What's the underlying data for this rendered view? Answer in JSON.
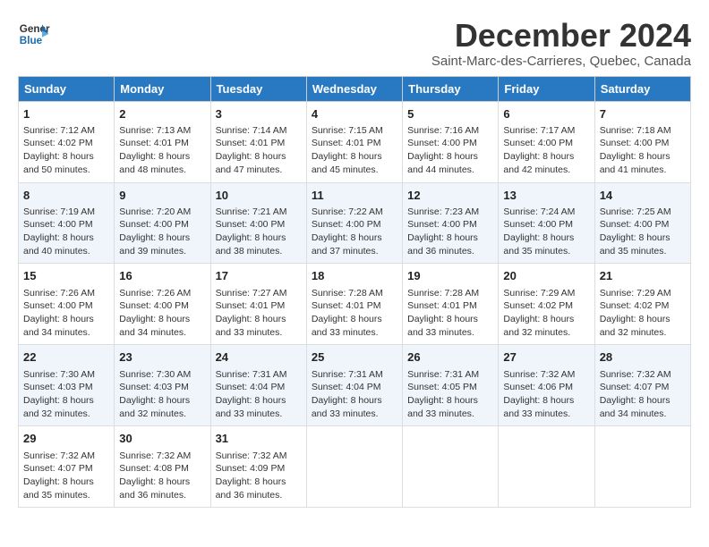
{
  "header": {
    "logo_line1": "General",
    "logo_line2": "Blue",
    "month": "December 2024",
    "location": "Saint-Marc-des-Carrieres, Quebec, Canada"
  },
  "weekdays": [
    "Sunday",
    "Monday",
    "Tuesday",
    "Wednesday",
    "Thursday",
    "Friday",
    "Saturday"
  ],
  "weeks": [
    [
      {
        "day": "1",
        "lines": [
          "Sunrise: 7:12 AM",
          "Sunset: 4:02 PM",
          "Daylight: 8 hours",
          "and 50 minutes."
        ]
      },
      {
        "day": "2",
        "lines": [
          "Sunrise: 7:13 AM",
          "Sunset: 4:01 PM",
          "Daylight: 8 hours",
          "and 48 minutes."
        ]
      },
      {
        "day": "3",
        "lines": [
          "Sunrise: 7:14 AM",
          "Sunset: 4:01 PM",
          "Daylight: 8 hours",
          "and 47 minutes."
        ]
      },
      {
        "day": "4",
        "lines": [
          "Sunrise: 7:15 AM",
          "Sunset: 4:01 PM",
          "Daylight: 8 hours",
          "and 45 minutes."
        ]
      },
      {
        "day": "5",
        "lines": [
          "Sunrise: 7:16 AM",
          "Sunset: 4:00 PM",
          "Daylight: 8 hours",
          "and 44 minutes."
        ]
      },
      {
        "day": "6",
        "lines": [
          "Sunrise: 7:17 AM",
          "Sunset: 4:00 PM",
          "Daylight: 8 hours",
          "and 42 minutes."
        ]
      },
      {
        "day": "7",
        "lines": [
          "Sunrise: 7:18 AM",
          "Sunset: 4:00 PM",
          "Daylight: 8 hours",
          "and 41 minutes."
        ]
      }
    ],
    [
      {
        "day": "8",
        "lines": [
          "Sunrise: 7:19 AM",
          "Sunset: 4:00 PM",
          "Daylight: 8 hours",
          "and 40 minutes."
        ]
      },
      {
        "day": "9",
        "lines": [
          "Sunrise: 7:20 AM",
          "Sunset: 4:00 PM",
          "Daylight: 8 hours",
          "and 39 minutes."
        ]
      },
      {
        "day": "10",
        "lines": [
          "Sunrise: 7:21 AM",
          "Sunset: 4:00 PM",
          "Daylight: 8 hours",
          "and 38 minutes."
        ]
      },
      {
        "day": "11",
        "lines": [
          "Sunrise: 7:22 AM",
          "Sunset: 4:00 PM",
          "Daylight: 8 hours",
          "and 37 minutes."
        ]
      },
      {
        "day": "12",
        "lines": [
          "Sunrise: 7:23 AM",
          "Sunset: 4:00 PM",
          "Daylight: 8 hours",
          "and 36 minutes."
        ]
      },
      {
        "day": "13",
        "lines": [
          "Sunrise: 7:24 AM",
          "Sunset: 4:00 PM",
          "Daylight: 8 hours",
          "and 35 minutes."
        ]
      },
      {
        "day": "14",
        "lines": [
          "Sunrise: 7:25 AM",
          "Sunset: 4:00 PM",
          "Daylight: 8 hours",
          "and 35 minutes."
        ]
      }
    ],
    [
      {
        "day": "15",
        "lines": [
          "Sunrise: 7:26 AM",
          "Sunset: 4:00 PM",
          "Daylight: 8 hours",
          "and 34 minutes."
        ]
      },
      {
        "day": "16",
        "lines": [
          "Sunrise: 7:26 AM",
          "Sunset: 4:00 PM",
          "Daylight: 8 hours",
          "and 34 minutes."
        ]
      },
      {
        "day": "17",
        "lines": [
          "Sunrise: 7:27 AM",
          "Sunset: 4:01 PM",
          "Daylight: 8 hours",
          "and 33 minutes."
        ]
      },
      {
        "day": "18",
        "lines": [
          "Sunrise: 7:28 AM",
          "Sunset: 4:01 PM",
          "Daylight: 8 hours",
          "and 33 minutes."
        ]
      },
      {
        "day": "19",
        "lines": [
          "Sunrise: 7:28 AM",
          "Sunset: 4:01 PM",
          "Daylight: 8 hours",
          "and 33 minutes."
        ]
      },
      {
        "day": "20",
        "lines": [
          "Sunrise: 7:29 AM",
          "Sunset: 4:02 PM",
          "Daylight: 8 hours",
          "and 32 minutes."
        ]
      },
      {
        "day": "21",
        "lines": [
          "Sunrise: 7:29 AM",
          "Sunset: 4:02 PM",
          "Daylight: 8 hours",
          "and 32 minutes."
        ]
      }
    ],
    [
      {
        "day": "22",
        "lines": [
          "Sunrise: 7:30 AM",
          "Sunset: 4:03 PM",
          "Daylight: 8 hours",
          "and 32 minutes."
        ]
      },
      {
        "day": "23",
        "lines": [
          "Sunrise: 7:30 AM",
          "Sunset: 4:03 PM",
          "Daylight: 8 hours",
          "and 32 minutes."
        ]
      },
      {
        "day": "24",
        "lines": [
          "Sunrise: 7:31 AM",
          "Sunset: 4:04 PM",
          "Daylight: 8 hours",
          "and 33 minutes."
        ]
      },
      {
        "day": "25",
        "lines": [
          "Sunrise: 7:31 AM",
          "Sunset: 4:04 PM",
          "Daylight: 8 hours",
          "and 33 minutes."
        ]
      },
      {
        "day": "26",
        "lines": [
          "Sunrise: 7:31 AM",
          "Sunset: 4:05 PM",
          "Daylight: 8 hours",
          "and 33 minutes."
        ]
      },
      {
        "day": "27",
        "lines": [
          "Sunrise: 7:32 AM",
          "Sunset: 4:06 PM",
          "Daylight: 8 hours",
          "and 33 minutes."
        ]
      },
      {
        "day": "28",
        "lines": [
          "Sunrise: 7:32 AM",
          "Sunset: 4:07 PM",
          "Daylight: 8 hours",
          "and 34 minutes."
        ]
      }
    ],
    [
      {
        "day": "29",
        "lines": [
          "Sunrise: 7:32 AM",
          "Sunset: 4:07 PM",
          "Daylight: 8 hours",
          "and 35 minutes."
        ]
      },
      {
        "day": "30",
        "lines": [
          "Sunrise: 7:32 AM",
          "Sunset: 4:08 PM",
          "Daylight: 8 hours",
          "and 36 minutes."
        ]
      },
      {
        "day": "31",
        "lines": [
          "Sunrise: 7:32 AM",
          "Sunset: 4:09 PM",
          "Daylight: 8 hours",
          "and 36 minutes."
        ]
      },
      null,
      null,
      null,
      null
    ]
  ]
}
